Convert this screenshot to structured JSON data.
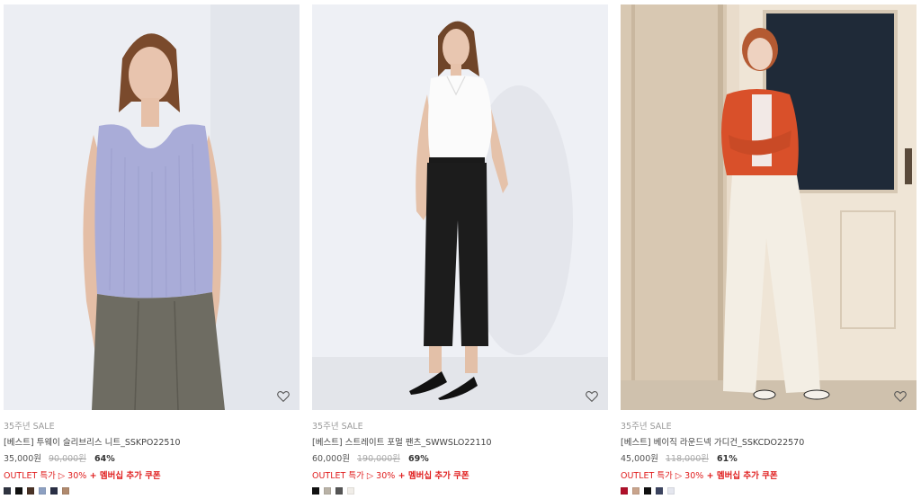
{
  "products": [
    {
      "badge": "35주년 SALE",
      "name": "[베스트] 투웨이 슬리브리스 니트_SSKPO22510",
      "price": "35,000원",
      "original_price": "90,000원",
      "discount": "64%",
      "promo_outlet": "OUTLET 특가 ▷ 30%",
      "promo_member": " + 멤버십 추가 쿠폰",
      "swatches": [
        "#2f3440",
        "#111111",
        "#4a3326",
        "#8da0c2",
        "#2a2f45",
        "#b08a6e"
      ],
      "wishlist_icon": "heart-outline-icon"
    },
    {
      "badge": "35주년 SALE",
      "name": "[베스트] 스트레이트 포멀 팬츠_SWWSLO22110",
      "price": "60,000원",
      "original_price": "190,000원",
      "discount": "69%",
      "promo_outlet": "OUTLET 특가 ▷ 30%",
      "promo_member": " + 멤버십 추가 쿠폰",
      "swatches": [
        "#111111",
        "#b9b2a6",
        "#555555",
        "#f0ede8"
      ],
      "wishlist_icon": "heart-outline-icon"
    },
    {
      "badge": "35주년 SALE",
      "name": "[베스트] 베이직 라운드넥 가디건_SSKCDO22570",
      "price": "45,000원",
      "original_price": "118,000원",
      "discount": "61%",
      "promo_outlet": "OUTLET 특가 ▷ 30%",
      "promo_member": " + 멤버십 추가 쿠폰",
      "swatches": [
        "#b0102a",
        "#c9a48c",
        "#111111",
        "#3c4460",
        "#e4e6ee"
      ],
      "wishlist_icon": "heart-outline-icon"
    }
  ]
}
